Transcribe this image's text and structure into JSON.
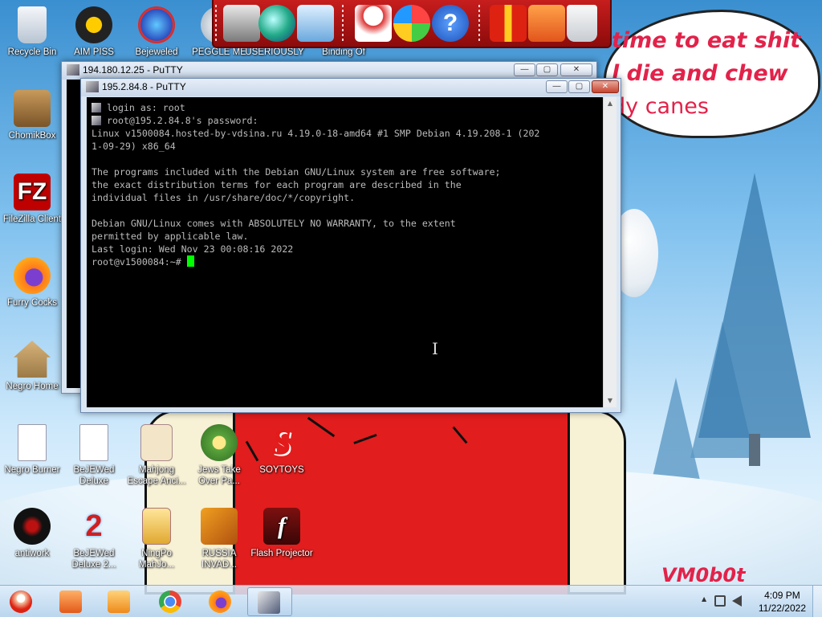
{
  "wallpaper": {
    "speech_lines": [
      "time to eat shit",
      "l die and chew",
      "dy canes"
    ],
    "signature": "VM0b0t"
  },
  "desktop_icons": [
    {
      "label": "Recycle Bin",
      "icon": "recycle-bin-icon"
    },
    {
      "label": "AIM PISS",
      "icon": "aim-icon"
    },
    {
      "label": "Bejeweled",
      "icon": "bejeweled-icon"
    },
    {
      "label": "PEGGLE ME",
      "icon": "peggle-icon"
    },
    {
      "label": "USERIOUSLY",
      "icon": "app-icon"
    },
    {
      "label": "Binding Of",
      "icon": "game-icon"
    },
    {
      "label": "ChomikBox",
      "icon": "chomikbox-icon"
    },
    {
      "label": "FileZilla Client",
      "icon": "filezilla-icon"
    },
    {
      "label": "Furry Cocks",
      "icon": "firefox-icon"
    },
    {
      "label": "Negro Home",
      "icon": "home-icon"
    },
    {
      "label": "Negro Burner",
      "icon": "document-icon"
    },
    {
      "label": "BeJEWed Deluxe",
      "icon": "document-icon"
    },
    {
      "label": "Mahjong Escape Anci...",
      "icon": "mahjong-icon"
    },
    {
      "label": "Jews Take Over Pa...",
      "icon": "plants-icon"
    },
    {
      "label": "SOYTOYS",
      "icon": "soytoys-icon"
    },
    {
      "label": "antiwork",
      "icon": "antiwork-icon"
    },
    {
      "label": "BeJEWed Deluxe 2...",
      "icon": "bejeweled2-icon"
    },
    {
      "label": "NingPo MahJo...",
      "icon": "ningpo-icon"
    },
    {
      "label": "RUSSIA INVAD...",
      "icon": "tetris-icon"
    },
    {
      "label": "Flash Projector",
      "icon": "flash-icon"
    }
  ],
  "toolbar_icons": [
    "computer-icon",
    "globe-icon",
    "network-icon",
    "snowman-icon",
    "windows-icon",
    "help-icon",
    "gift-icon",
    "folder-icon",
    "trash-icon"
  ],
  "back_window": {
    "title": "194.180.12.25 - PuTTY",
    "minimize": "—",
    "maximize": "▢",
    "close": "✕"
  },
  "front_window": {
    "title": "195.2.84.8 - PuTTY",
    "minimize": "—",
    "maximize": "▢",
    "close": "✕"
  },
  "terminal": {
    "line1": " login as: root",
    "line2": " root@195.2.84.8's password:",
    "line3": "Linux v1500084.hosted-by-vdsina.ru 4.19.0-18-amd64 #1 SMP Debian 4.19.208-1 (202",
    "line4": "1-09-29) x86_64",
    "line5": "",
    "line6": "The programs included with the Debian GNU/Linux system are free software;",
    "line7": "the exact distribution terms for each program are described in the",
    "line8": "individual files in /usr/share/doc/*/copyright.",
    "line9": "",
    "line10": "Debian GNU/Linux comes with ABSOLUTELY NO WARRANTY, to the extent",
    "line11": "permitted by applicable law.",
    "line12": "Last login: Wed Nov 23 00:08:16 2022",
    "prompt": "root@v1500084:~# "
  },
  "taskbar": {
    "start": "start-button",
    "pinned": [
      "file-explorer-icon",
      "media-player-icon",
      "chrome-icon",
      "firefox-icon",
      "putty-icon"
    ],
    "active_index": 4,
    "time": "4:09 PM",
    "date": "11/22/2022",
    "tray_arrow": "▲"
  },
  "colors": {
    "terminal_bg": "#000000",
    "terminal_fg": "#bbbbbb",
    "cursor": "#00ff00",
    "speech_text": "#e2224a"
  }
}
